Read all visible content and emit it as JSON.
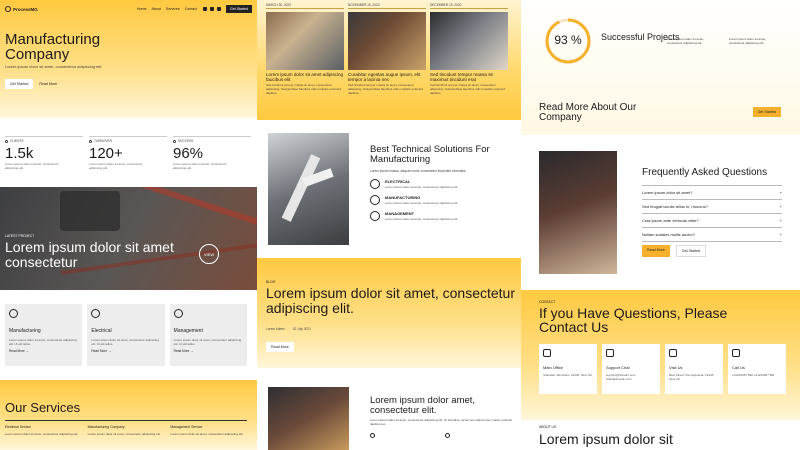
{
  "col1": {
    "logo": "ProcessMG",
    "nav": [
      "Home",
      "About",
      "Services",
      "Contact"
    ],
    "nav_button": "Get Started",
    "hero_title": "Manufacturing Company",
    "hero_subtitle": "Lorem ipsum dolor sit amet, consectetur adipiscing elit.",
    "hero_primary": "Get Started",
    "hero_secondary": "Read More",
    "stats": [
      {
        "label": "CLIENTS",
        "value": "1.5k",
        "desc": "Lorem ipsum dolor sit amet, consectetur adipiscing elit."
      },
      {
        "label": "TURNOVER",
        "value": "120+",
        "desc": "Lorem ipsum dolor sit amet, consectetur adipiscing elit."
      },
      {
        "label": "SUCCESS",
        "value": "96%",
        "desc": "Lorem ipsum dolor sit amet, consectetur adipiscing elit."
      }
    ],
    "latest_tag": "LATEST PROJECT",
    "latest_title": "Lorem ipsum dolor sit amet consectetur",
    "badge": "VIEW",
    "cards": [
      {
        "title": "Manufacturing",
        "desc": "Lorem ipsum dolor sit amet, consectetur adipiscing elit. Ut elit tellus.",
        "more": "Read More →"
      },
      {
        "title": "Electrical",
        "desc": "Lorem ipsum dolor sit amet, consectetur adipiscing elit. Ut elit tellus.",
        "more": "Read More →"
      },
      {
        "title": "Management",
        "desc": "Lorem ipsum dolor sit amet, consectetur adipiscing elit. Ut elit tellus.",
        "more": "Read More →"
      }
    ],
    "services_title": "Our Services",
    "services": [
      {
        "title": "Electrical Service",
        "desc": "Lorem ipsum dolor sit amet, consectetur adipiscing elit."
      },
      {
        "title": "Manufacturing Company",
        "desc": "Lorem ipsum dolor sit amet, consectetur adipiscing elit."
      },
      {
        "title": "Management Service",
        "desc": "Lorem ipsum dolor sit amet, consectetur adipiscing elit."
      }
    ]
  },
  "col2": {
    "blog_cards": [
      {
        "date": "MARCH 30, 2020",
        "title": "Lorem ipsum dolor sit amet adipiscing faucibus elit",
        "desc": "Sed tincidunt tempor massa sit amet, consectetur adipiscing. Suspendisse faucibus odio molestie euismod dapibus."
      },
      {
        "date": "NOVEMBER 15, 2020",
        "title": "Curabitur egestas augue ipsum, elit tempor a lacinia nec",
        "desc": "Sed tincidunt tempor massa sit amet, consectetur adipiscing. Suspendisse faucibus odio molestie euismod dapibus."
      },
      {
        "date": "DECEMBER 19, 2020",
        "title": "Sed tincidunt tempor massa sit maximus tincidunt erat",
        "desc": "Sed tincidunt tempor massa sit amet, consectetur adipiscing. Suspendisse faucibus odio molestie euismod dapibus."
      }
    ],
    "tech_title": "Best Technical Solutions For Manufacturing",
    "tech_desc": "Lorem ipsum massa, aliquam dolor consectetur imperdiet venenatis.",
    "features": [
      {
        "title": "ELECTRICAL",
        "desc": "Lorem ipsum dolor sit amet, consectetur adipiscing elit."
      },
      {
        "title": "MANUFACTURING",
        "desc": "Lorem ipsum dolor sit amet, consectetur adipiscing elit."
      },
      {
        "title": "MANAGEMENT",
        "desc": "Lorem ipsum dolor sit amet, consectetur adipiscing elit."
      }
    ],
    "blog_tag": "BLOG",
    "blog_title": "Lorem ipsum dolor sit amet, consectetur adipiscing elit.",
    "blog_author": "Lorem Admin",
    "blog_date": "20 July 2021",
    "blog_button": "Read More",
    "blog2_title": "Lorem ipsum dolor amet, consectetur elit.",
    "blog2_desc": "Lorem ipsum dolor sit amet, consectetur adipiscing elit. Ut elit tellus, luctus nec ullamcorper mattis, pulvinar dapibus leo."
  },
  "col3": {
    "percent": "93 %",
    "percent_value": 93,
    "success_title": "Successful Projects",
    "success_cols": [
      "Lorem ipsum dolor sit amet, consectetur adipiscing elit.",
      "Lorem ipsum dolor sit amet, consectetur adipiscing elit."
    ],
    "read_more_title": "Read More About Our Company",
    "read_more_button": "Get Started",
    "faq_title": "Frequently Asked Questions",
    "faq": [
      "Lorem ipsum dolor sit amet?",
      "Sed feugiat iaculis tellus in, rhoncus?",
      "Cras ipsum ante vehicula vitae?",
      "Nullam sodales mollis auctor?"
    ],
    "faq_btn1": "Read More",
    "faq_btn2": "Get Started",
    "contact_tag": "CONTACT",
    "contact_title": "If you Have Questions, Please Contact Us",
    "contact_cards": [
      {
        "title": "Main Office",
        "desc": "Sharasar, Merchant, 12345, New UK"
      },
      {
        "title": "Support Chat",
        "desc": "support@domain.com hello@domain.com"
      },
      {
        "title": "Visit Us",
        "desc": "Best Street, Pennsylvania, 12345 New UK"
      },
      {
        "title": "Call Us",
        "desc": "+01234567 890 +01234567 891"
      }
    ],
    "about_tag": "ABOUT US",
    "about_title": "Lorem ipsum dolor sit"
  }
}
